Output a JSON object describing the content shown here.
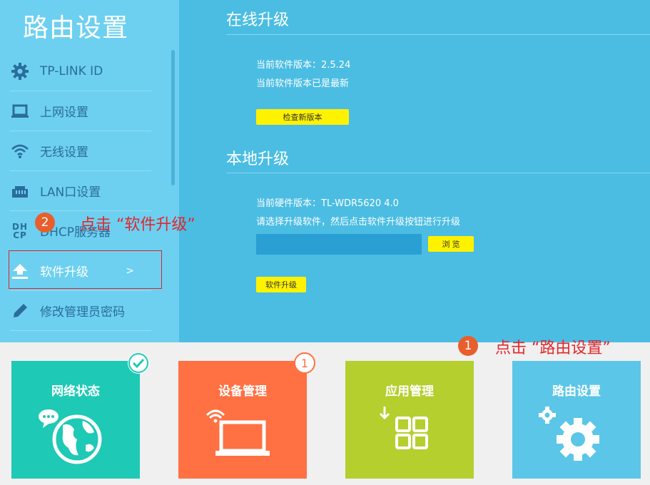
{
  "sidebar": {
    "title": "路由设置",
    "items": [
      {
        "label": "TP-LINK ID",
        "icon": "gear-icon"
      },
      {
        "label": "上网设置",
        "icon": "laptop-icon"
      },
      {
        "label": "无线设置",
        "icon": "wifi-icon"
      },
      {
        "label": "LAN口设置",
        "icon": "lan-port-icon"
      },
      {
        "label": "DHCP服务器",
        "icon": "dhcp-icon",
        "icon_text": "DH CP"
      },
      {
        "label": "软件升级",
        "icon": "upload-icon",
        "arrow": ">"
      },
      {
        "label": "修改管理员密码",
        "icon": "pencil-icon"
      }
    ]
  },
  "main": {
    "online": {
      "title": "在线升级",
      "current_version": "当前软件版本：2.5.24",
      "status": "当前软件版本已是最新",
      "check_button": "检查新版本"
    },
    "local": {
      "title": "本地升级",
      "hardware_version": "当前硬件版本：TL-WDR5620 4.0",
      "instruction": "请选择升级软件，然后点击软件升级按钮进行升级",
      "browse_button": "浏 览",
      "upgrade_button": "软件升级"
    }
  },
  "annotations": {
    "step1_number": "1",
    "step1_text": "点击 “路由设置”",
    "step2_number": "2",
    "step2_text": "点击 “软件升级”"
  },
  "tiles": [
    {
      "label": "网络状态",
      "color": "#1ec9b5",
      "badge": "check"
    },
    {
      "label": "设备管理",
      "color": "#ff7043",
      "badge": "1"
    },
    {
      "label": "应用管理",
      "color": "#b5cf2e"
    },
    {
      "label": "路由设置",
      "color": "#5bc6e8"
    }
  ],
  "colors": {
    "sidebar_bg": "#6dd0f0",
    "main_bg": "#4bbde3",
    "button_yellow": "#fff200",
    "annotation_red": "#e0282e",
    "badge_orange": "#e85e2c"
  }
}
